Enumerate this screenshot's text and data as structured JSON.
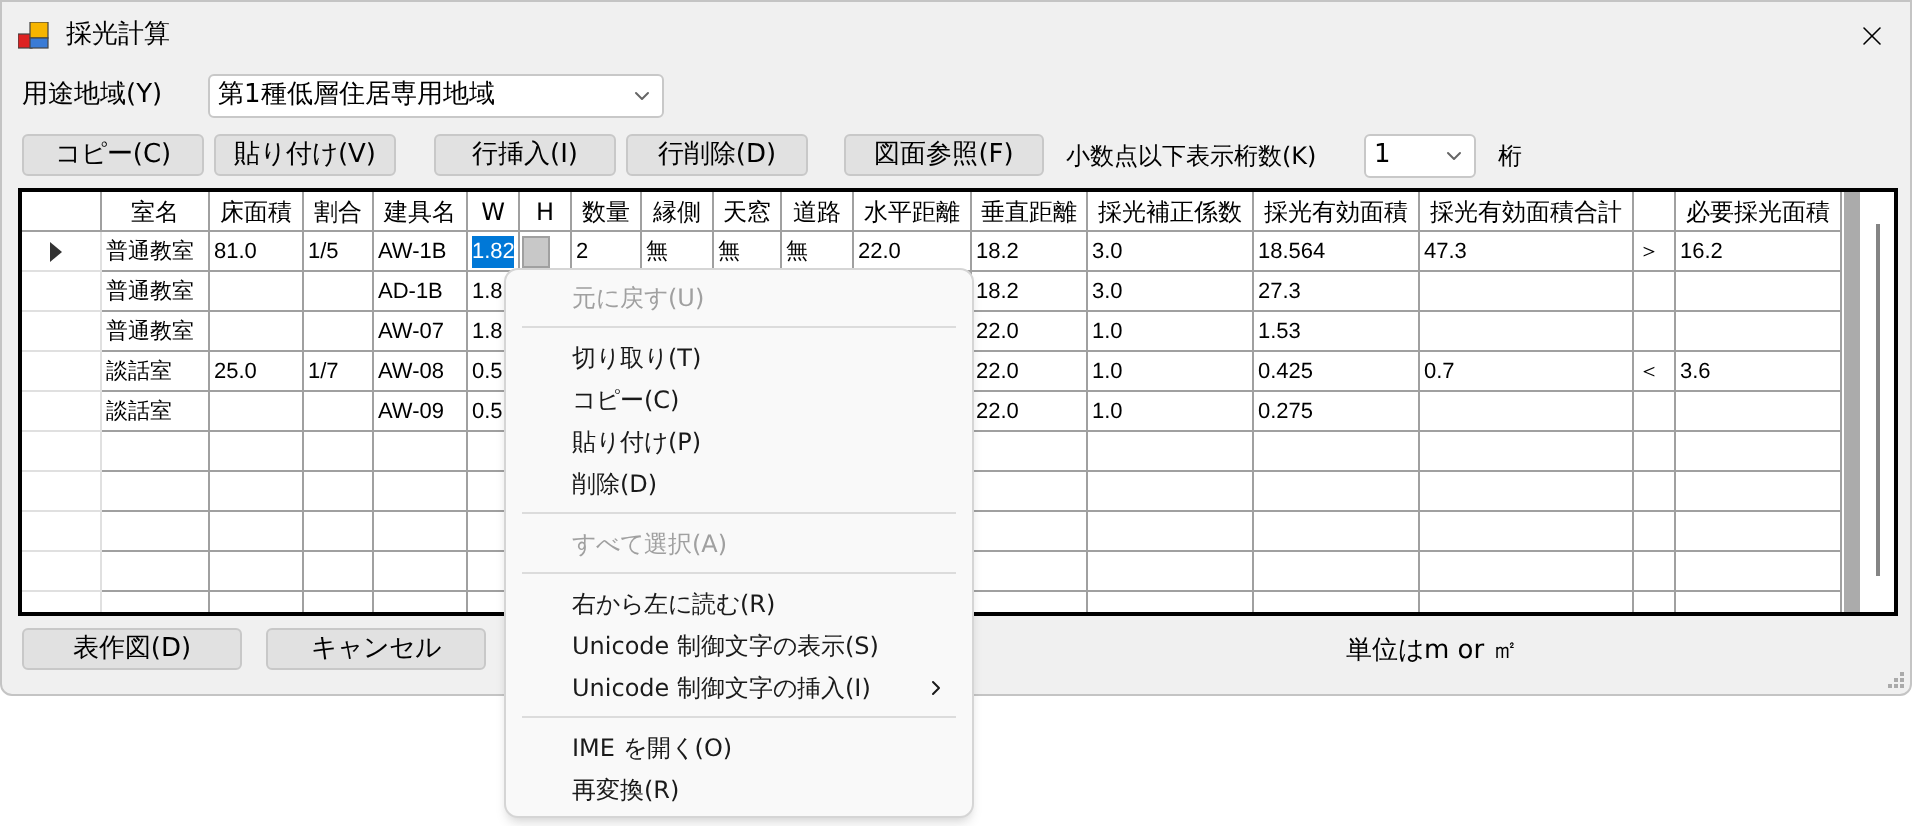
{
  "window": {
    "title": "採光計算"
  },
  "zoning": {
    "label": "用途地域(Y)",
    "value": "第1種低層住居専用地域"
  },
  "toolbar": [
    "コピー(C)",
    "貼り付け(V)",
    "行挿入(I)",
    "行削除(D)",
    "図面参照(F)"
  ],
  "decimals": {
    "label": "小数点以下表示桁数(K)",
    "value": "1",
    "unit": "桁"
  },
  "table": {
    "columns": [
      {
        "label": "室名"
      },
      {
        "label": "床面積"
      },
      {
        "label": "割合"
      },
      {
        "label": "建具名"
      },
      {
        "label": "W"
      },
      {
        "label": "H"
      },
      {
        "label": "数量"
      },
      {
        "label": "縁側"
      },
      {
        "label": "天窓"
      },
      {
        "label": "道路"
      },
      {
        "label": "水平距離"
      },
      {
        "label": "垂直距離"
      },
      {
        "label": "採光補正係数"
      },
      {
        "label": "採光有効面積"
      },
      {
        "label": "採光有効面積合計"
      },
      {},
      {
        "label": "必要採光面積"
      }
    ],
    "rows": [
      {
        "current": true,
        "cells": [
          "普通教室",
          "81.0",
          "1/5",
          "AW-1B",
          {
            "text": "1.82",
            "selected": true
          },
          {
            "kind": "dropdown"
          },
          "2",
          "無",
          "無",
          "無",
          "22.0",
          "18.2",
          "3.0",
          "18.564",
          "47.3",
          "＞",
          "16.2"
        ]
      },
      {
        "current": false,
        "cells": [
          "普通教室",
          null,
          null,
          "AD-1B",
          "1.8",
          null,
          null,
          null,
          null,
          null,
          null,
          "18.2",
          "3.0",
          "27.3",
          null,
          null,
          null
        ]
      },
      {
        "current": false,
        "cells": [
          "普通教室",
          null,
          null,
          "AW-07",
          "1.8",
          null,
          null,
          null,
          null,
          null,
          null,
          "22.0",
          "1.0",
          "1.53",
          null,
          null,
          null
        ]
      },
      {
        "current": false,
        "cells": [
          "談話室",
          "25.0",
          "1/7",
          "AW-08",
          "0.5",
          null,
          null,
          null,
          null,
          null,
          null,
          "22.0",
          "1.0",
          "0.425",
          "0.7",
          "＜",
          "3.6"
        ]
      },
      {
        "current": false,
        "cells": [
          "談話室",
          null,
          null,
          "AW-09",
          "0.5",
          null,
          null,
          null,
          null,
          null,
          null,
          "22.0",
          "1.0",
          "0.275",
          null,
          null,
          null
        ]
      }
    ]
  },
  "bottom_buttons": [
    "表作図(D)",
    "キャンセル"
  ],
  "unit_note": "単位はm or ㎡",
  "context_menu": [
    {
      "kind": "item",
      "label": "元に戻す(U)",
      "disabled": true
    },
    {
      "kind": "separator"
    },
    {
      "kind": "item",
      "label": "切り取り(T)",
      "disabled": false
    },
    {
      "kind": "item",
      "label": "コピー(C)",
      "disabled": false
    },
    {
      "kind": "item",
      "label": "貼り付け(P)",
      "disabled": false
    },
    {
      "kind": "item",
      "label": "削除(D)",
      "disabled": false
    },
    {
      "kind": "separator"
    },
    {
      "kind": "item",
      "label": "すべて選択(A)",
      "disabled": true
    },
    {
      "kind": "separator"
    },
    {
      "kind": "item",
      "label": "右から左に読む(R)",
      "disabled": false
    },
    {
      "kind": "item",
      "label": "Unicode 制御文字の表示(S)",
      "disabled": false
    },
    {
      "kind": "item",
      "label": "Unicode 制御文字の挿入(I)",
      "disabled": false,
      "submenu": true
    },
    {
      "kind": "separator"
    },
    {
      "kind": "item",
      "label": "IME を開く(O)",
      "disabled": false
    },
    {
      "kind": "item",
      "label": "再変換(R)",
      "disabled": false
    }
  ]
}
